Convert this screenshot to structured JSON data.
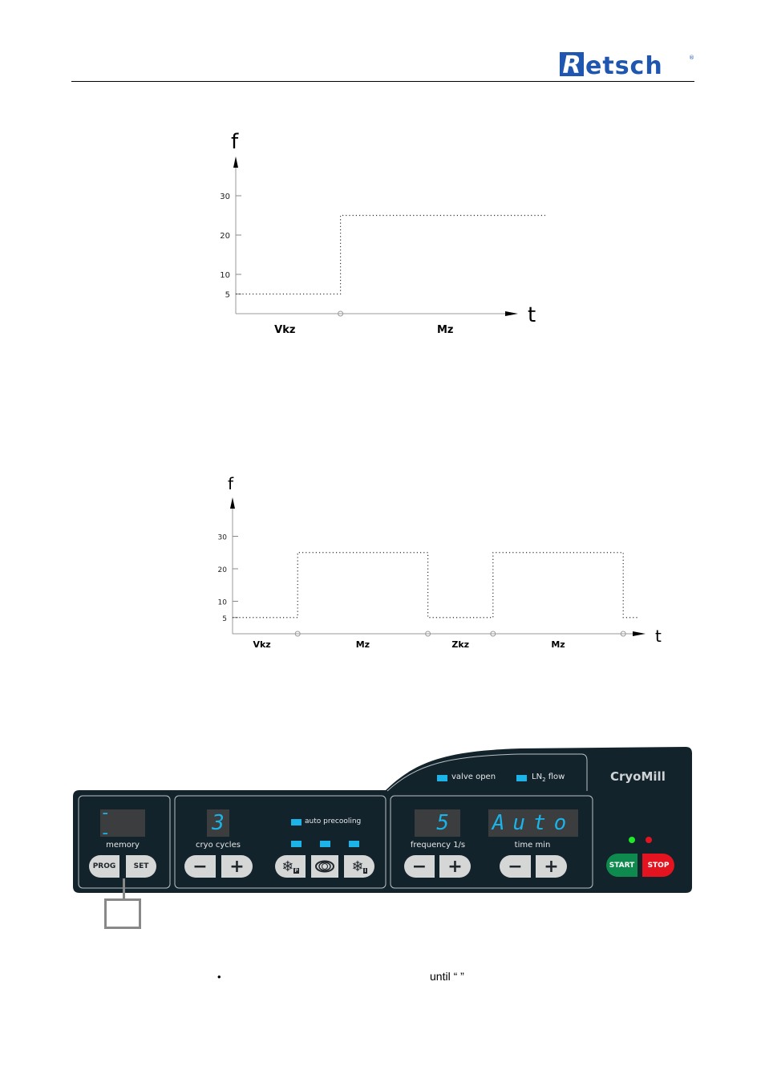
{
  "header": {
    "logo_text": "Retsch",
    "logo_initial": "R",
    "logo_rest": "etsch",
    "logo_mark": "®",
    "brand_color": "#1f56b0"
  },
  "chart_data": [
    {
      "type": "line",
      "title": "",
      "xlabel": "t",
      "ylabel": "f",
      "yticks": [
        5,
        10,
        20,
        30
      ],
      "ylim": [
        0,
        40
      ],
      "xlim": [
        0,
        6
      ],
      "step": true,
      "x": [
        0,
        2,
        2,
        6,
        6
      ],
      "y": [
        5,
        5,
        25,
        25,
        0
      ],
      "segments": [
        {
          "label": "Vkz",
          "from": 0,
          "to": 2
        },
        {
          "label": "Mz",
          "from": 2,
          "to": 6
        }
      ]
    },
    {
      "type": "line",
      "title": "",
      "xlabel": "t",
      "ylabel": "f",
      "yticks": [
        5,
        10,
        20,
        30
      ],
      "ylim": [
        0,
        40
      ],
      "xlim": [
        0,
        10.3
      ],
      "step": true,
      "x": [
        0,
        2,
        2,
        6,
        6,
        8,
        8,
        12,
        12,
        12.5
      ],
      "y": [
        5,
        5,
        25,
        25,
        5,
        5,
        25,
        25,
        5,
        5
      ],
      "segments": [
        {
          "label": "Vkz",
          "from": 0,
          "to": 2
        },
        {
          "label": "Mz",
          "from": 2,
          "to": 6
        },
        {
          "label": "Zkz",
          "from": 6,
          "to": 8
        },
        {
          "label": "Mz",
          "from": 8,
          "to": 12
        }
      ]
    }
  ],
  "panel": {
    "product_name": "CryoMill",
    "memory": {
      "display": "- -",
      "label": "memory",
      "prog": "PROG",
      "set": "SET"
    },
    "cryo_cycles": {
      "display": "3",
      "label": "cryo cycles",
      "minus": "−",
      "plus": "+"
    },
    "precooling": {
      "label": "auto precooling",
      "modes": [
        "precool-P",
        "grinding",
        "precool-I"
      ]
    },
    "valve": {
      "valve_open": "valve open",
      "ln2_flow_prefix": "LN",
      "ln2_flow_sub": "2",
      "ln2_flow_suffix": " flow"
    },
    "frequency": {
      "display": "5",
      "label": "frequency 1/s",
      "minus": "−",
      "plus": "+"
    },
    "time": {
      "display": "Auto",
      "label": "time min",
      "minus": "−",
      "plus": "+"
    },
    "start": "START",
    "stop": "STOP",
    "colors": {
      "panel": "#13232b",
      "led": "#1bb3e8",
      "start": "#0f8a4e",
      "stop": "#e3141f",
      "green_led": "#1de82a",
      "red_led": "#e3141f"
    }
  },
  "body_text": {
    "bullet": "•",
    "until": "until “   ”"
  }
}
